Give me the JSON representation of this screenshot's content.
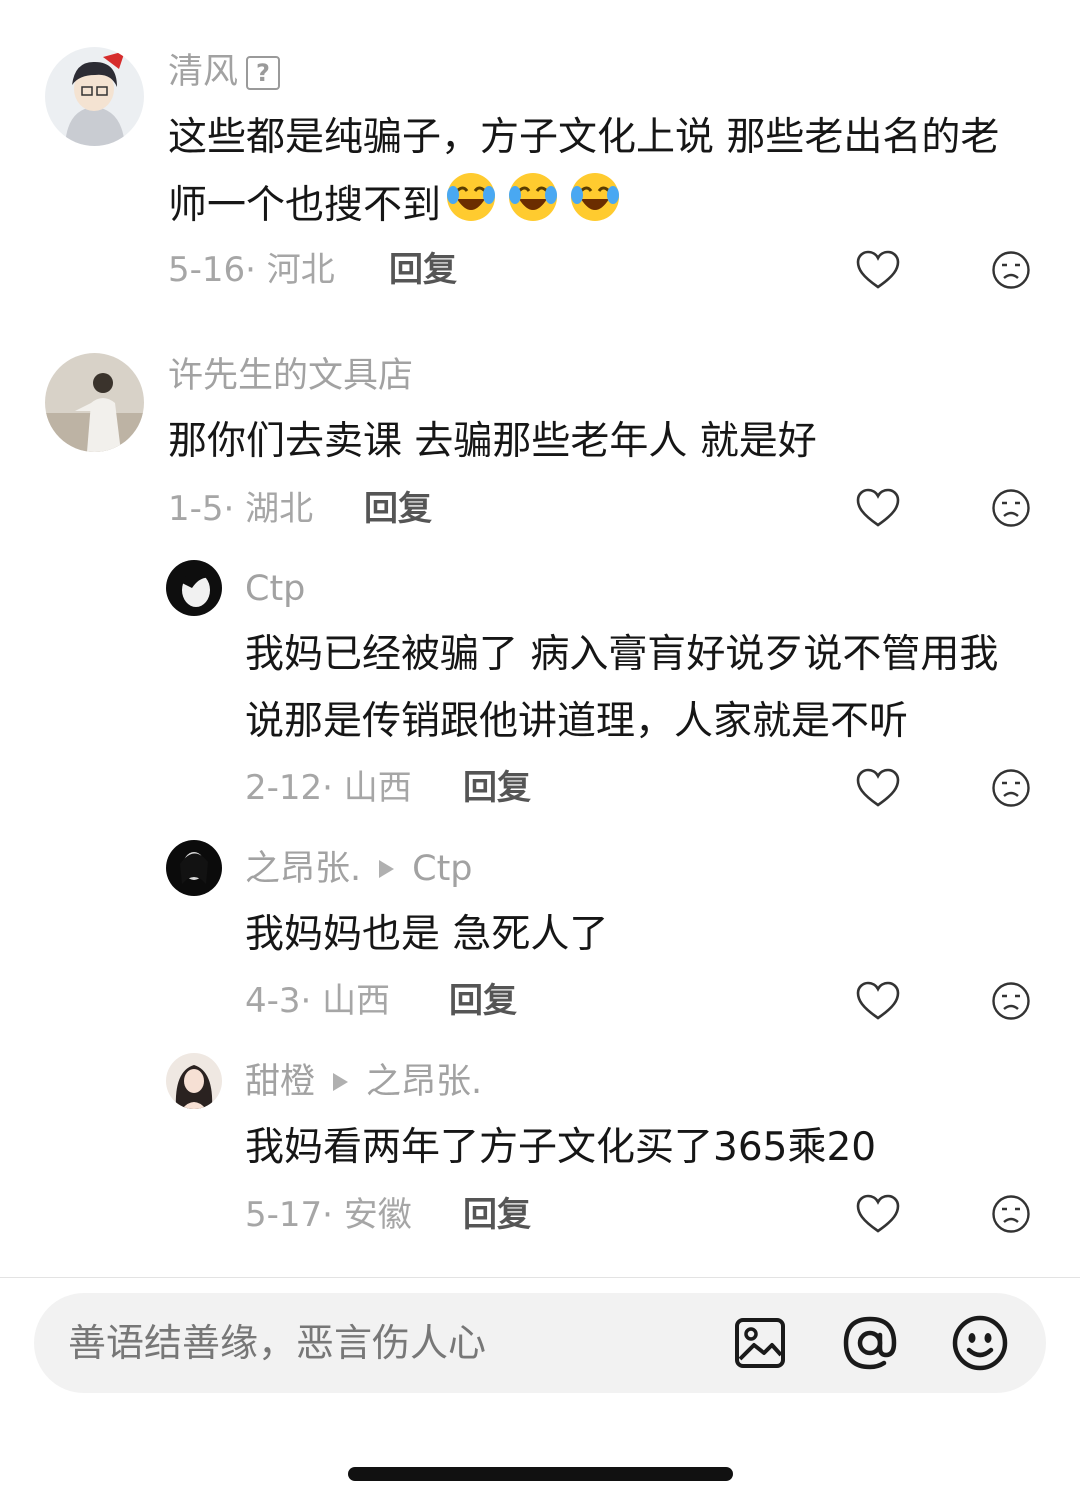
{
  "comments": [
    {
      "username": "清风",
      "badge": "?",
      "text": "这些都是纯骗子，方子文化上说 那些老出名的老师一个也搜不到",
      "date": "5-16",
      "location": "河北",
      "reply_label": "回复",
      "emoji": "laughing-crying-face"
    },
    {
      "username": "许先生的文具店",
      "text": "那你们去卖课 去骗那些老年人 就是好",
      "date": "1-5",
      "location": "湖北",
      "reply_label": "回复"
    },
    {
      "username": "Ctp",
      "text": "我妈已经被骗了 病入膏肓好说歹说不管用我说那是传销跟他讲道理，人家就是不听",
      "date": "2-12",
      "location": "山西",
      "reply_label": "回复"
    },
    {
      "username": "之昂张.",
      "reply_to": "Ctp",
      "text": "我妈妈也是 急死人了",
      "date": "4-3",
      "location": "山西",
      "reply_label": "回复"
    },
    {
      "username": "甜橙",
      "reply_to": "之昂张.",
      "text": "我妈看两年了方子文化买了365乘20",
      "date": "5-17",
      "location": "安徽",
      "reply_label": "回复"
    }
  ],
  "input": {
    "placeholder": "善语结善缘，恶言伤人心"
  },
  "icons": {
    "like": "heart-outline-icon",
    "dislike": "frown-face-icon",
    "image": "image-icon",
    "mention": "at-icon",
    "emoji": "smile-face-icon"
  },
  "colors": {
    "text": "#161616",
    "muted": "#a6a6a6",
    "input_bg": "#f2f2f2"
  }
}
